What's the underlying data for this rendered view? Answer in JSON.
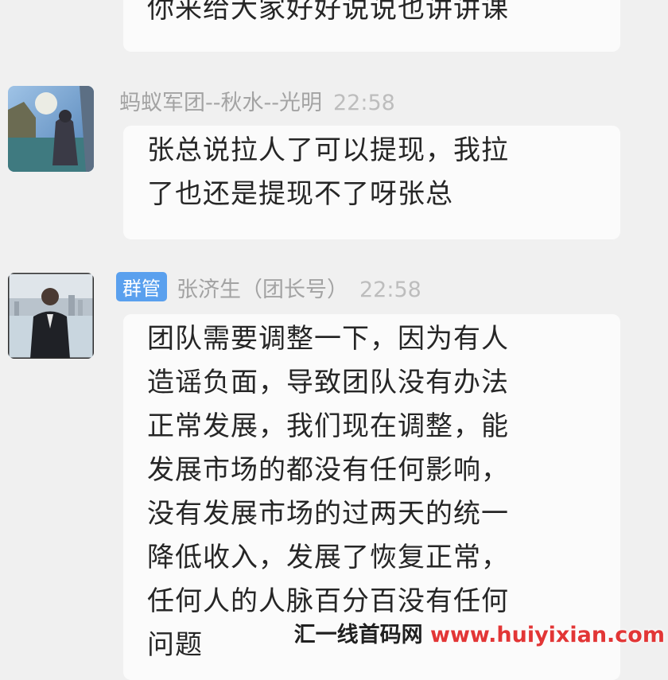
{
  "messages": [
    {
      "lines": [
        "你来给大家好好说说也讲讲课"
      ]
    },
    {
      "sender": "蚂蚁军团--秋水--光明",
      "time": "22:58",
      "lines": [
        "张总说拉人了可以提现，我拉",
        "了也还是提现不了呀张总"
      ]
    },
    {
      "badge": "群管",
      "sender": "张济生（团长号）",
      "time": "22:58",
      "lines": [
        "团队需要调整一下，因为有人",
        "造谣负面，导致团队没有办法",
        "正常发展，我们现在调整，能",
        "发展市场的都没有任何影响，",
        "没有发展市场的过两天的统一",
        "降低收入，发展了恢复正常，",
        "任何人的人脉百分百没有任何",
        "问题"
      ]
    }
  ],
  "watermark": {
    "name": "汇一线首码网",
    "url": "www.huiyixian.com"
  }
}
